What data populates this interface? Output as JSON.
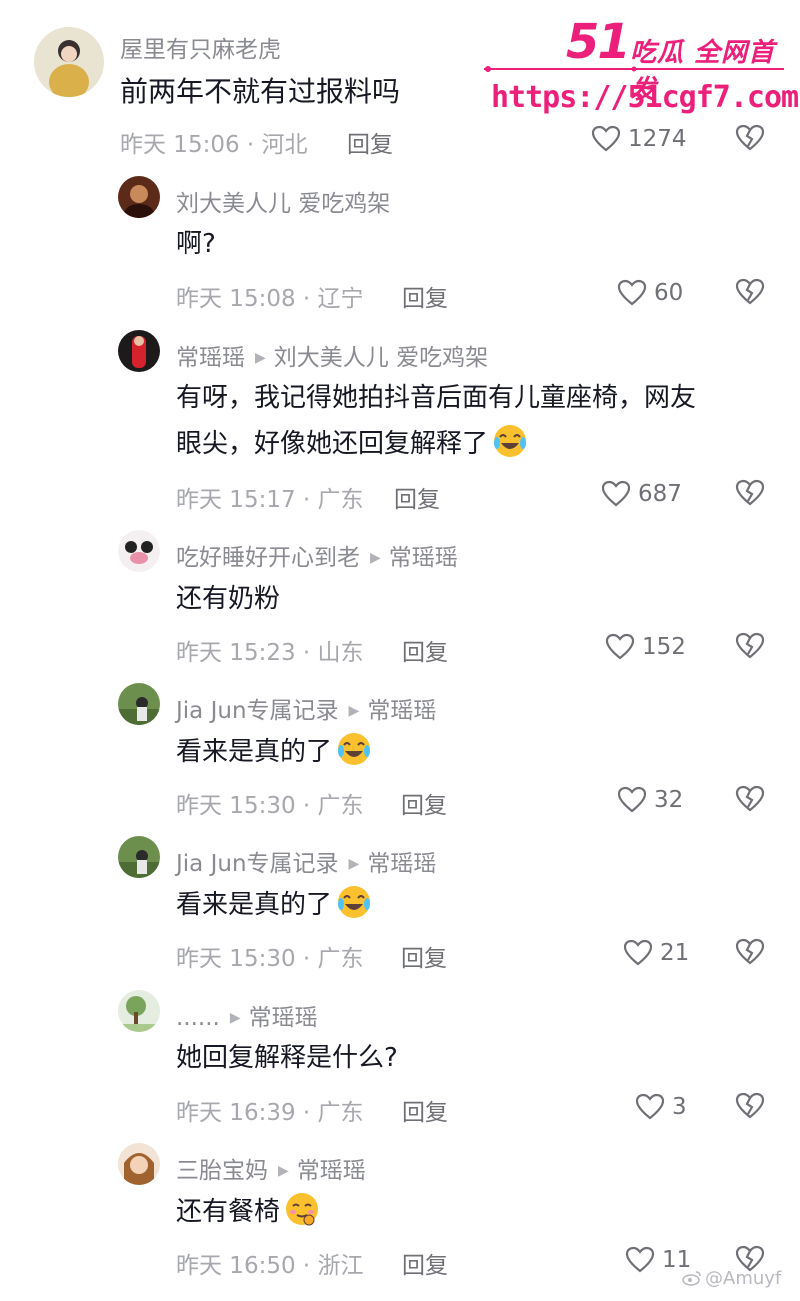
{
  "watermark": {
    "brand_number": "51",
    "brand_slogan": "吃瓜 全网首发",
    "url": "https://51cgf7.com",
    "weibo_handle": "@Amuyf",
    "color": "#ec1f7a"
  },
  "comments": [
    {
      "username": "屋里有只麻老虎",
      "text": "前两年不就有过报料吗",
      "time_location": "昨天 15:06 · 河北",
      "reply_label": "回复",
      "likes": "1274"
    },
    {
      "username": "刘大美人儿 爱吃鸡架",
      "text": "啊?",
      "time_location": "昨天 15:08 · 辽宁",
      "reply_label": "回复",
      "likes": "60"
    },
    {
      "username": "常瑶瑶",
      "reply_to": "刘大美人儿 爱吃鸡架",
      "text_line1": "有呀，我记得她拍抖音后面有儿童座椅，网友",
      "text_line2": "眼尖，好像她还回复解释了",
      "emoji": "crying-laughing",
      "time_location": "昨天 15:17 · 广东",
      "reply_label": "回复",
      "likes": "687"
    },
    {
      "username": "吃好睡好开心到老",
      "reply_to": "常瑶瑶",
      "text": "还有奶粉",
      "time_location": "昨天 15:23 · 山东",
      "reply_label": "回复",
      "likes": "152"
    },
    {
      "username": "Jia Jun专属记录",
      "reply_to": "常瑶瑶",
      "text": "看来是真的了",
      "emoji": "crying-laughing",
      "time_location": "昨天 15:30 · 广东",
      "reply_label": "回复",
      "likes": "32"
    },
    {
      "username": "Jia Jun专属记录",
      "reply_to": "常瑶瑶",
      "text": "看来是真的了",
      "emoji": "crying-laughing",
      "time_location": "昨天 15:30 · 广东",
      "reply_label": "回复",
      "likes": "21"
    },
    {
      "username": "......",
      "reply_to": "常瑶瑶",
      "text": "她回复解释是什么?",
      "time_location": "昨天 16:39 · 广东",
      "reply_label": "回复",
      "likes": "3"
    },
    {
      "username": "三胎宝妈",
      "reply_to": "常瑶瑶",
      "text": "还有餐椅",
      "emoji": "shy-smile",
      "time_location": "昨天 16:50 · 浙江",
      "reply_label": "回复",
      "likes": "11"
    }
  ],
  "icons": {
    "like": "heart-outline-icon",
    "dislike": "broken-heart-icon",
    "reply_arrow": "triangle-right-icon"
  }
}
